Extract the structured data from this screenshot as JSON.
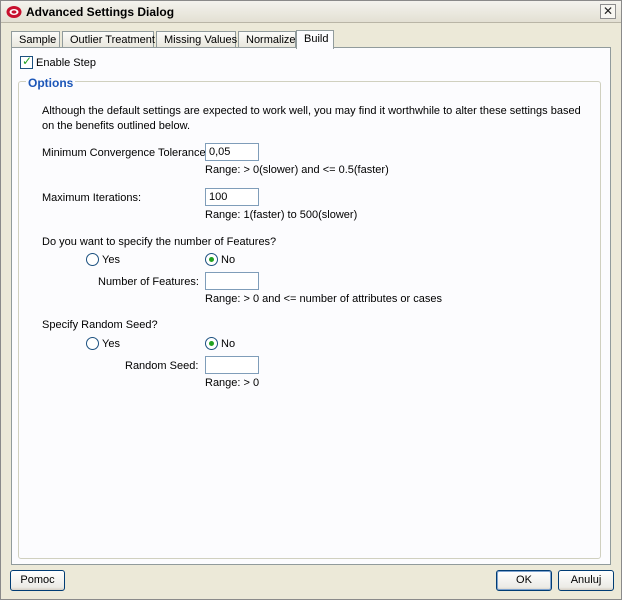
{
  "window": {
    "title": "Advanced Settings Dialog",
    "close_glyph": "✕"
  },
  "tabs": [
    {
      "label": "Sample",
      "active": false
    },
    {
      "label": "Outlier Treatment",
      "active": false
    },
    {
      "label": "Missing Values",
      "active": false
    },
    {
      "label": "Normalize",
      "active": false
    },
    {
      "label": "Build",
      "active": true
    }
  ],
  "enable_step": {
    "label": "Enable Step",
    "checked": true
  },
  "options": {
    "legend": "Options",
    "intro": "Although the default settings are expected to work well, you may find it worthwhile to alter these settings based on the benefits outlined below.",
    "convergence": {
      "label": "Minimum Convergence Tolerance:",
      "value": "0,05",
      "range": "Range: > 0(slower) and <= 0.5(faster)"
    },
    "iterations": {
      "label": "Maximum Iterations:",
      "value": "100",
      "range": "Range: 1(faster) to 500(slower)"
    },
    "features": {
      "question": "Do you want to specify the number of Features?",
      "yes_label": "Yes",
      "no_label": "No",
      "selected": "No",
      "count_label": "Number of Features:",
      "count_value": "",
      "range": "Range: > 0 and <= number of attributes or cases"
    },
    "seed": {
      "question": "Specify Random Seed?",
      "yes_label": "Yes",
      "no_label": "No",
      "selected": "No",
      "seed_label": "Random Seed:",
      "seed_value": "",
      "range": "Range: > 0"
    }
  },
  "footer": {
    "help_label": "Pomoc",
    "ok_label": "OK",
    "cancel_label": "Anuluj"
  },
  "colors": {
    "legend": "#1c56b8",
    "dialog_bg": "#ece9d8",
    "panel_bg": "#fcfcfe",
    "accent_green": "#21a121"
  }
}
